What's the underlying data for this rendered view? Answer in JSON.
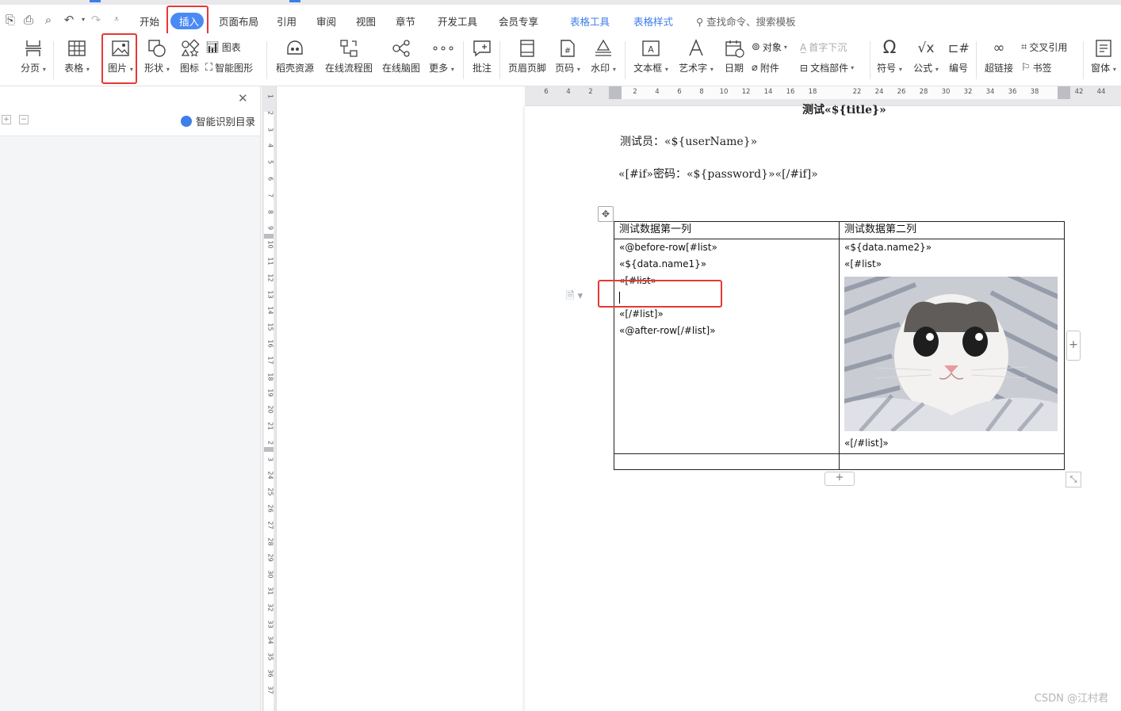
{
  "quick_access": {
    "icons": [
      "export-icon",
      "print-icon",
      "print-preview-icon",
      "undo-icon",
      "redo-icon",
      "customize-icon"
    ]
  },
  "menu": {
    "tabs": [
      "开始",
      "插入",
      "页面布局",
      "引用",
      "审阅",
      "视图",
      "章节",
      "开发工具",
      "会员专享"
    ],
    "context_tabs": [
      "表格工具",
      "表格样式"
    ],
    "active_tab": "插入",
    "search_placeholder": "查找命令、搜索模板"
  },
  "ribbon": {
    "page_break": "分页",
    "table": "表格",
    "picture": "图片",
    "shape": "形状",
    "icon": "图标",
    "chart": "图表",
    "smart_shape": "智能图形",
    "docer_resources": "稻壳资源",
    "online_flowchart": "在线流程图",
    "online_mindmap": "在线脑图",
    "more": "更多",
    "comment": "批注",
    "header_footer": "页眉页脚",
    "page_number": "页码",
    "watermark": "水印",
    "text_box": "文本框",
    "word_art": "艺术字",
    "date": "日期",
    "object": "对象",
    "drop_cap": "首字下沉",
    "attachment": "附件",
    "doc_parts": "文档部件",
    "symbol": "符号",
    "formula": "公式",
    "numbering": "编号",
    "hyperlink": "超链接",
    "cross_reference": "交叉引用",
    "bookmark": "书签",
    "form": "窗体"
  },
  "nav_panel": {
    "smart_toc": "智能识别目录"
  },
  "rulers": {
    "horizontal": [
      "6",
      "4",
      "2",
      "2",
      "4",
      "6",
      "8",
      "10",
      "12",
      "14",
      "16",
      "18",
      "22",
      "24",
      "26",
      "28",
      "30",
      "32",
      "34",
      "36",
      "38",
      "42",
      "44"
    ],
    "vertical": [
      "1",
      "2",
      "3",
      "4",
      "5",
      "6",
      "7",
      "8",
      "9",
      "10",
      "11",
      "12",
      "13",
      "14",
      "15",
      "16",
      "17",
      "18",
      "19",
      "20",
      "21",
      "2",
      "3",
      "24",
      "25",
      "26",
      "27",
      "28",
      "29",
      "30",
      "31",
      "32",
      "33",
      "34",
      "35",
      "36",
      "37"
    ]
  },
  "document": {
    "title": "测试«${title}»",
    "tester_line": "测试员：«${userName}»",
    "password_line": "«[#if»密码：«${password}»«[/#if]»",
    "table": {
      "headers": [
        "测试数据第一列",
        "测试数据第二列"
      ],
      "col1_lines": [
        "«@before-row[#list»",
        "«${data.name1}»",
        "«[#list»",
        "",
        "«[/#list]»",
        "«@after-row[/#list]»"
      ],
      "col2_top": [
        "«${data.name2}»",
        "«[#list»"
      ],
      "col2_bottom": "«[/#list]»",
      "image_alt": "cat-photo"
    }
  },
  "watermark": "CSDN @江村君"
}
